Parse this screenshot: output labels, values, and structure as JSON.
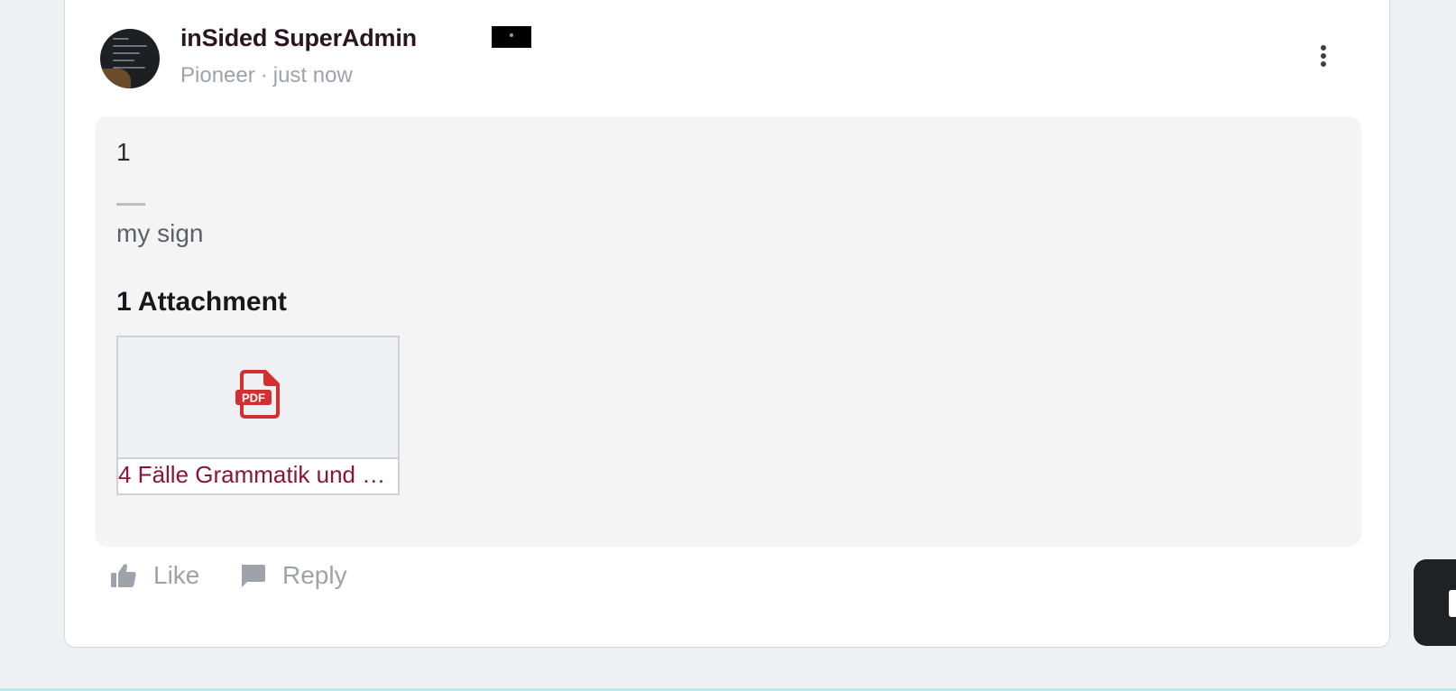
{
  "post": {
    "author_name": "inSided SuperAdmin",
    "author_rank": "Pioneer",
    "separator": "·",
    "timestamp": "just now",
    "body": "1",
    "signature": "my sign",
    "attachments_heading": "1 Attachment",
    "attachments": [
      {
        "file_name": "4 Fälle Grammatik und …",
        "file_type": "PDF",
        "icon": "pdf-file-icon"
      }
    ]
  },
  "actions": {
    "like_label": "Like",
    "reply_label": "Reply"
  },
  "colors": {
    "page_background": "#eff0f4",
    "card_background": "#ffffff",
    "content_background": "#f4f4f5",
    "attachment_link": "#8b1538",
    "pdf_icon": "#d32f2f",
    "muted_text": "#9ea2ab"
  },
  "icons": {
    "more": "more-vertical-icon",
    "like": "thumbs-up-icon",
    "reply": "chat-bubble-icon",
    "badge": "rank-badge-icon"
  }
}
